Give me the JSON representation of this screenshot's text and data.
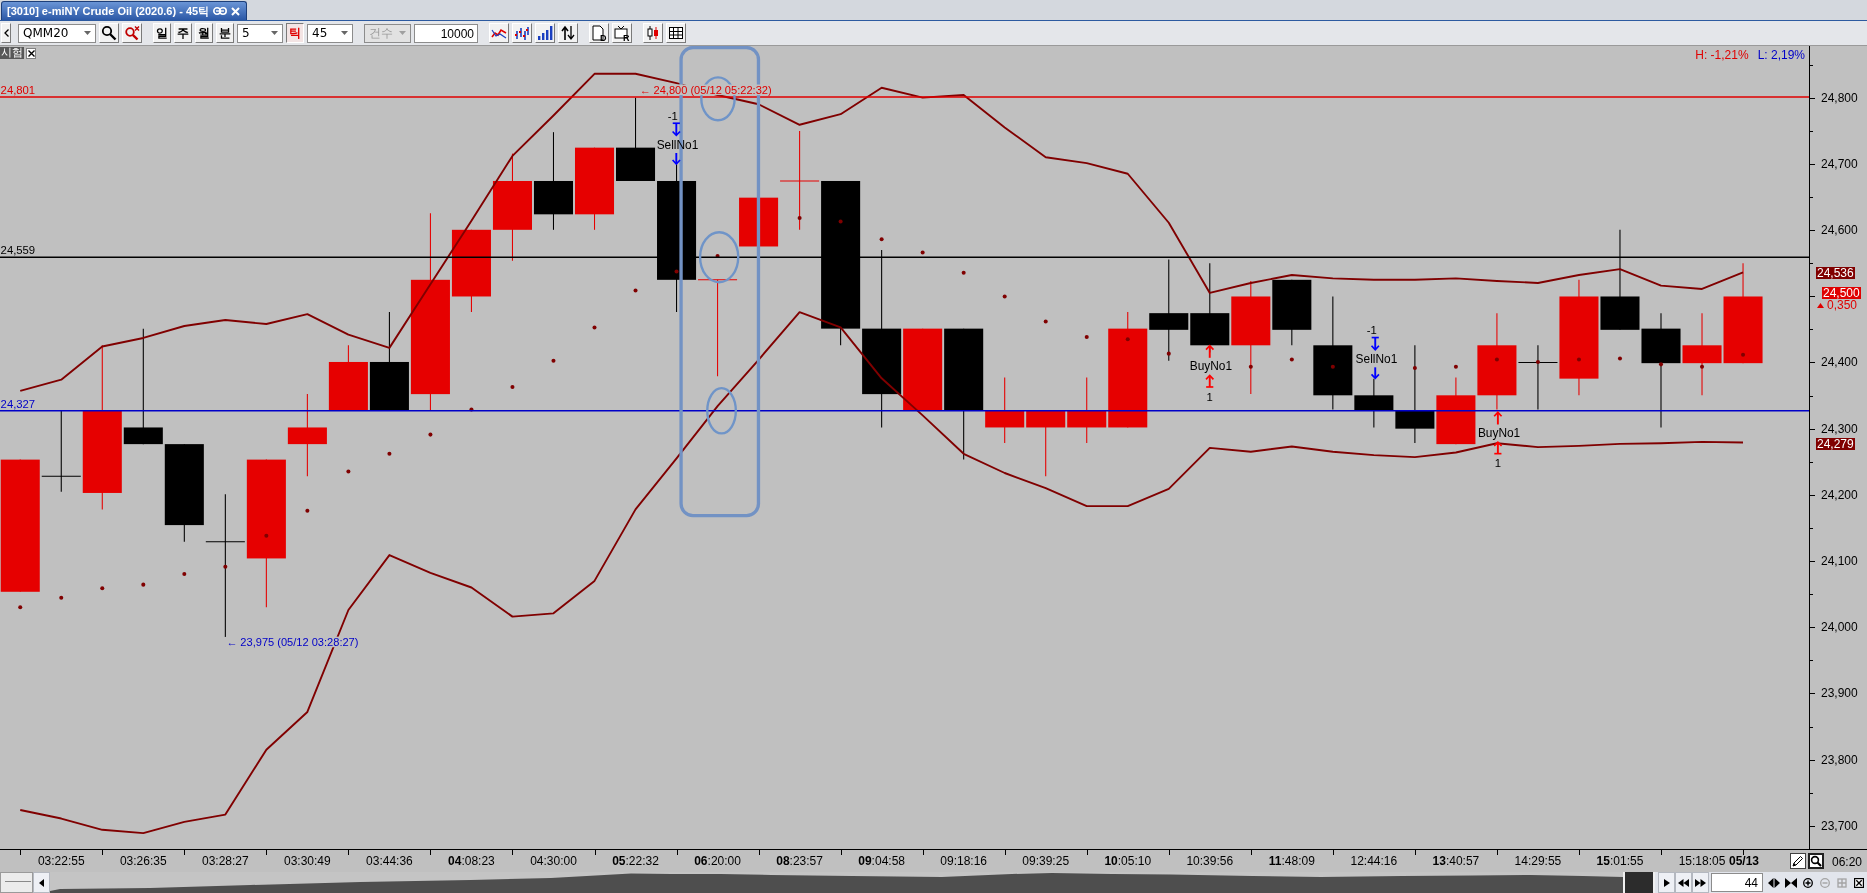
{
  "window": {
    "title": "[3010] e-miNY Crude Oil (2020.6) - 45틱"
  },
  "toolbar": {
    "symbol": "QMM20",
    "periods": [
      {
        "label": "일",
        "selected": false
      },
      {
        "label": "주",
        "selected": false
      },
      {
        "label": "월",
        "selected": false
      },
      {
        "label": "분",
        "selected": false,
        "interval": "5"
      },
      {
        "label": "틱",
        "selected": true,
        "interval": "45"
      }
    ],
    "count_mode": {
      "value": "건수",
      "disabled": true
    },
    "count": "10000",
    "document_button": {
      "letter": "D"
    },
    "monitor_button": {
      "letter": "R"
    }
  },
  "chart": {
    "tag": "시험",
    "high": "H: -1,21%",
    "low": "L: 2,19%",
    "chart_data": {
      "type": "line",
      "categories": [
        null,
        "03:22:55",
        null,
        "03:26:35",
        null,
        "03:28:27",
        null,
        "03:30:49",
        null,
        "03:44:36",
        null,
        "**04**:08:23",
        null,
        "04:30:00",
        null,
        "**05**:22:32",
        null,
        "**06**:20:00",
        null,
        "**08**:23:57",
        null,
        "**09**:04:58",
        null,
        "09:18:16",
        null,
        "09:39:25",
        null,
        "**10**:05:10",
        null,
        "10:39:56",
        null,
        "**11**:48:09",
        null,
        "12:44:16",
        null,
        "**13**:40:57",
        null,
        "14:29:55",
        null,
        "**15**:01:55",
        null,
        "15:18:05",
        null
      ],
      "ylim": [
        23.665,
        24.878
      ],
      "yticks": [
        {
          "value": 24.8,
          "label": "24,800"
        },
        {
          "value": 24.7,
          "label": "24,700"
        },
        {
          "value": 24.6,
          "label": "24,600"
        },
        {
          "value": 24.4,
          "label": "24,400"
        },
        {
          "value": 24.3,
          "label": "24,300"
        },
        {
          "value": 24.2,
          "label": "24,200"
        },
        {
          "value": 24.1,
          "label": "24,100"
        },
        {
          "value": 24.0,
          "label": "24,000"
        },
        {
          "value": 23.9,
          "label": "23,900"
        },
        {
          "value": 23.8,
          "label": "23,800"
        },
        {
          "value": 23.7,
          "label": "23,700"
        }
      ],
      "series": [
        {
          "color": "#800000",
          "values": [
            24.357,
            24.374,
            24.424,
            24.437,
            24.455,
            24.464,
            24.458,
            24.473,
            24.442,
            24.422,
            24.518,
            24.614,
            24.712,
            24.773,
            24.836,
            24.836,
            24.822,
            24.804,
            24.79,
            24.759,
            24.775,
            24.815,
            24.8,
            24.804,
            24.755,
            24.71,
            24.701,
            24.685,
            24.611,
            24.505,
            24.52,
            24.532,
            24.527,
            24.525,
            24.525,
            24.527,
            24.523,
            24.52,
            24.532,
            24.541,
            24.516,
            24.511,
            24.536
          ]
        },
        {
          "color": "#800000",
          "values": [
            23.724,
            23.711,
            23.694,
            23.689,
            23.706,
            23.717,
            23.815,
            23.872,
            24.026,
            24.109,
            24.082,
            24.06,
            24.016,
            24.021,
            24.07,
            24.178,
            24.255,
            24.334,
            24.404,
            24.476,
            24.453,
            24.376,
            24.32,
            24.262,
            24.233,
            24.21,
            24.183,
            24.183,
            24.209,
            24.271,
            24.265,
            24.273,
            24.265,
            24.26,
            24.257,
            24.264,
            24.278,
            24.272,
            24.274,
            24.277,
            24.278,
            24.28,
            24.279
          ]
        }
      ],
      "ref_lines": [
        {
          "axis": "y",
          "value": 24.801,
          "label": "24,801",
          "color": "#e00000"
        },
        {
          "axis": "y",
          "value": 24.559,
          "label": "24,559",
          "color": "#000000"
        },
        {
          "axis": "y",
          "value": 24.327,
          "label": "24,327",
          "color": "#0000c8"
        }
      ]
    },
    "notes": [
      {
        "text": "← 24,800 (05/12 05:22:32)",
        "color": "#e00000"
      },
      {
        "text": "← 23,975 (05/12 03:28:27)",
        "color": "#0000c8"
      }
    ],
    "signals": [
      {
        "kind": "sell",
        "label": "SellNo1",
        "quantity": "-1"
      },
      {
        "kind": "buy",
        "label": "BuyNo1",
        "quantity": "1"
      },
      {
        "kind": "sell",
        "label": "SellNo1",
        "quantity": "-1"
      },
      {
        "kind": "buy",
        "label": "BuyNo1",
        "quantity": "1"
      }
    ]
  },
  "price_axis": {
    "tags": [
      {
        "text": "24,536",
        "color": "#800000"
      },
      {
        "text": "24,500",
        "color": "#e00000"
      },
      {
        "text": "24,279",
        "color": "#800000"
      }
    ],
    "change": {
      "value": "0,350",
      "rising": true
    }
  },
  "time_axis": {
    "date": "05/13",
    "time": "06:20"
  },
  "navigator": {
    "count": "44",
    "zoom_buttons": [
      {
        "disabled": false
      },
      {
        "disabled": true
      },
      {
        "disabled": true
      }
    ]
  }
}
